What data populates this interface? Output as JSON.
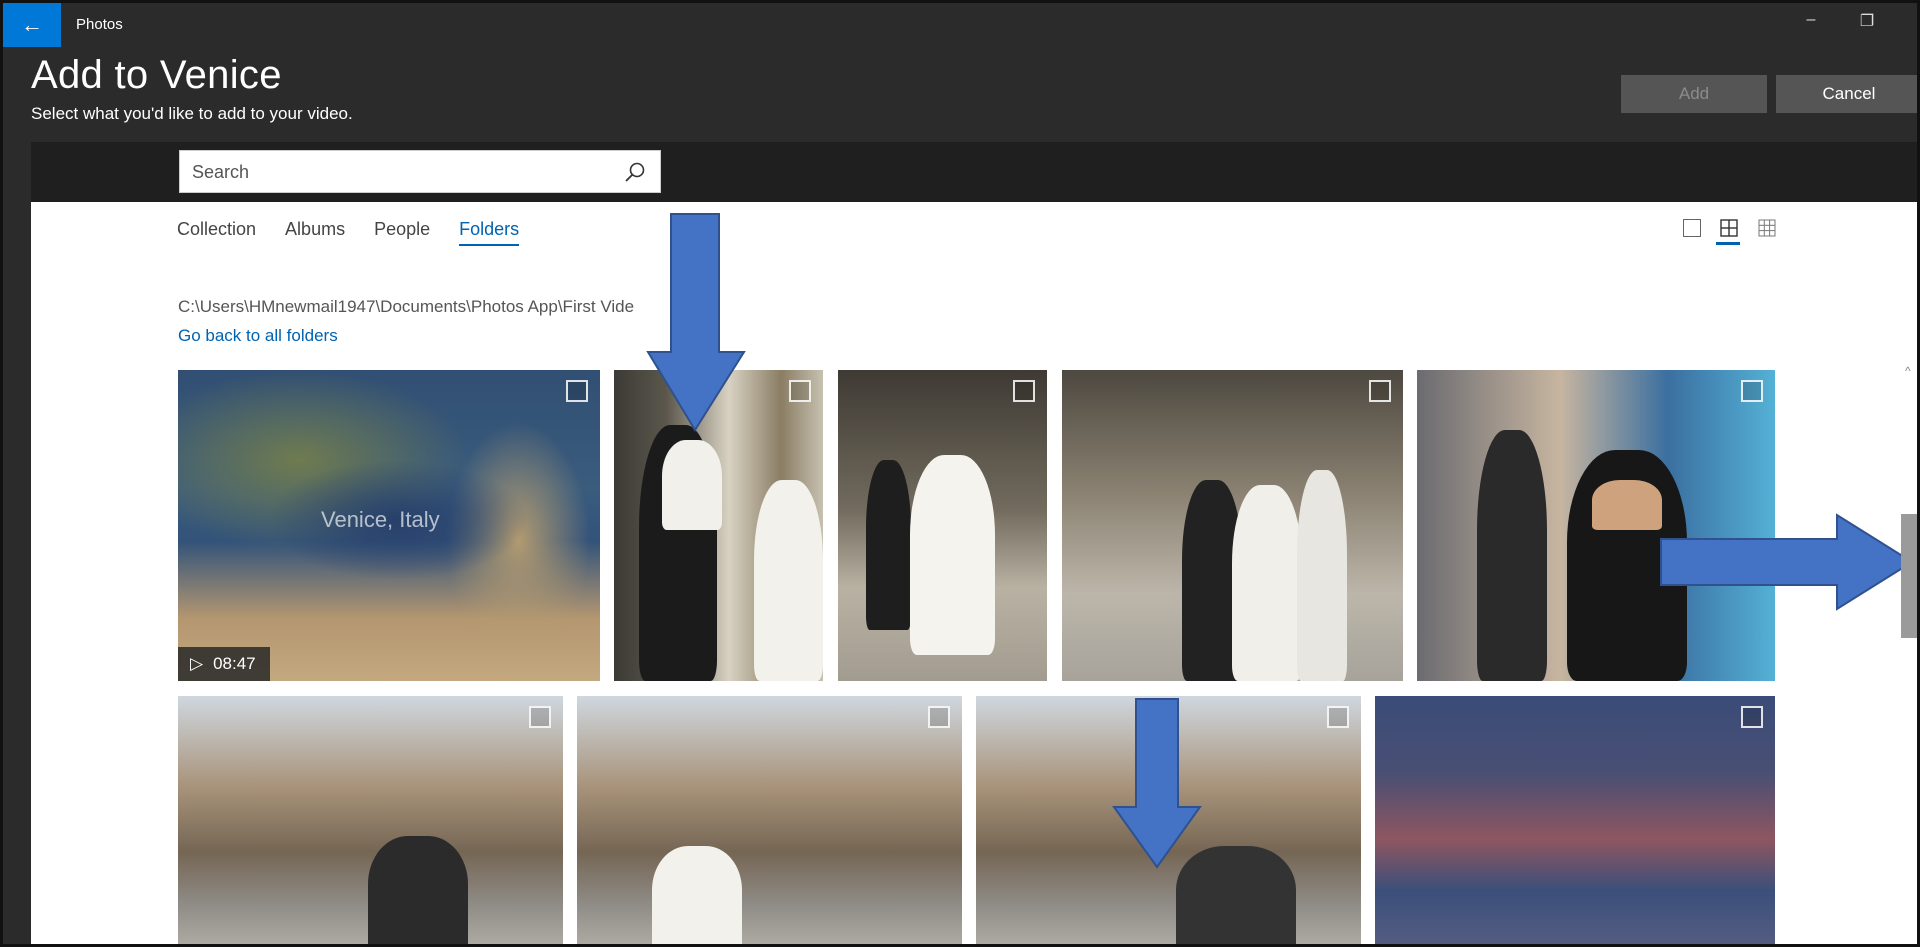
{
  "titlebar": {
    "back_icon": "back-arrow-icon",
    "app_name": "Photos",
    "minimize": "–",
    "maximize": "❐",
    "close": "✕"
  },
  "header": {
    "title": "Add to Venice",
    "subtitle": "Select what you'd like to add to your video.",
    "add_label": "Add",
    "cancel_label": "Cancel"
  },
  "search": {
    "placeholder": "Search",
    "icon": "search-icon"
  },
  "tabs": [
    {
      "label": "Collection",
      "active": false
    },
    {
      "label": "Albums",
      "active": false
    },
    {
      "label": "People",
      "active": false
    },
    {
      "label": "Folders",
      "active": true
    }
  ],
  "view_modes": [
    "large-tile-icon",
    "medium-tile-icon",
    "small-tile-icon"
  ],
  "folder": {
    "path": "C:\\Users\\HMnewmail1947\\Documents\\Photos App\\First Vide",
    "back_link": "Go back to all folders"
  },
  "tiles": [
    {
      "kind": "video",
      "label": "Venice, Italy",
      "duration": "08:47"
    },
    {
      "kind": "photo",
      "subject": "groom"
    },
    {
      "kind": "photo",
      "subject": "bride-and-groom"
    },
    {
      "kind": "photo",
      "subject": "wedding-couple-piazza"
    },
    {
      "kind": "photo",
      "subject": "crowd-with-pigeons"
    },
    {
      "kind": "photo",
      "subject": "basilica-1"
    },
    {
      "kind": "photo",
      "subject": "basilica-2"
    },
    {
      "kind": "photo",
      "subject": "basilica-3"
    },
    {
      "kind": "photo",
      "subject": "grand-canal"
    }
  ],
  "annotations": {
    "arrow_color": "#4472c4"
  },
  "colors": {
    "accent": "#0078d7",
    "link": "#0063b1",
    "chrome": "#2b2b2b"
  }
}
